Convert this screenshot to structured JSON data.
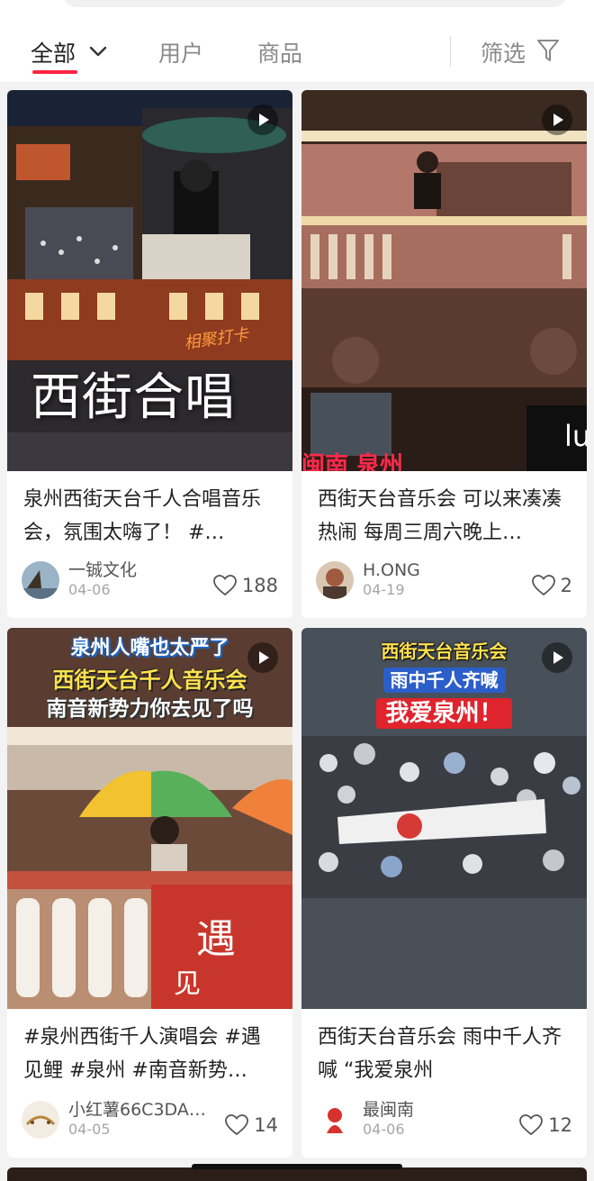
{
  "filter_bar": {
    "tabs": [
      {
        "label": "全部",
        "active": true
      },
      {
        "label": "用户",
        "active": false
      },
      {
        "label": "商品",
        "active": false
      }
    ],
    "filter_label": "筛选",
    "accent_color": "#ff2442"
  },
  "feed": [
    {
      "overlay_big": "西街合唱",
      "overlay_small": "相聚打卡",
      "title": "泉州西街天台千人合唱音乐会，氛围太嗨了！ #…",
      "author": "一铖文化",
      "date": "04-06",
      "likes": "188",
      "is_video": true
    },
    {
      "overlay_sign": "闽南 泉州",
      "title": "西街天台音乐会 可以来凑凑热闹 每周三周六晚上…",
      "author": "H.ONG",
      "date": "04-19",
      "likes": "2",
      "is_video": true
    },
    {
      "overlay_lines": [
        "泉州人嘴也太严了",
        "西街天台千人音乐会",
        "南音新势力你去见了吗"
      ],
      "title": "#泉州西街千人演唱会 #遇见鲤 #泉州 #南音新势…",
      "author": "小红薯66C3DA…",
      "date": "04-05",
      "likes": "14",
      "is_video": true
    },
    {
      "overlay_lines": [
        "西街天台音乐会",
        "雨中千人齐喊",
        "我爱泉州！"
      ],
      "title": "西街天台音乐会 雨中千人齐喊 “我爱泉州",
      "author": "最闽南",
      "date": "04-06",
      "likes": "12",
      "is_video": true
    }
  ]
}
